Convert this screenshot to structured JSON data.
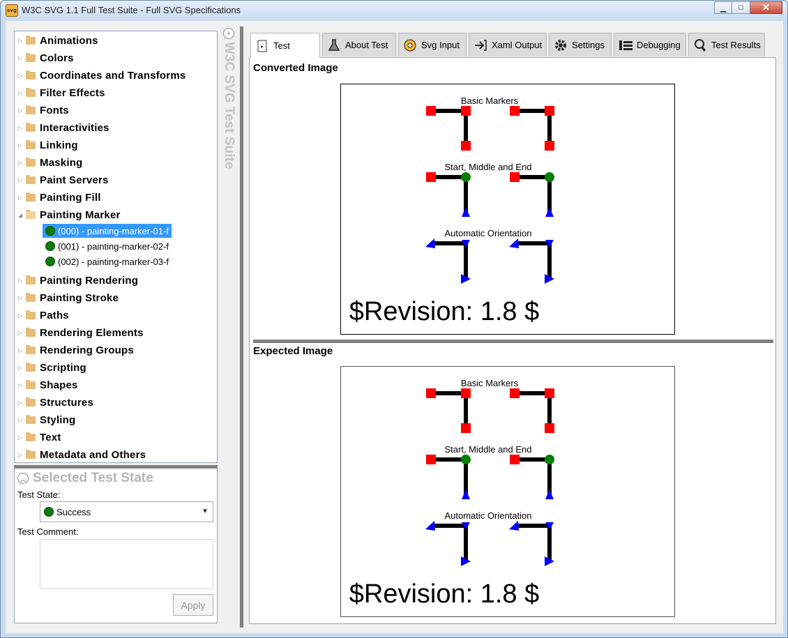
{
  "window": {
    "title": "W3C SVG 1.1 Full Test Suite - Full SVG Specifications",
    "icon_text": "svg"
  },
  "strip": {
    "title": "W3C SVG Test Suite"
  },
  "tree": {
    "categories": [
      "Animations",
      "Colors",
      "Coordinates and Transforms",
      "Filter Effects",
      "Fonts",
      "Interactivities",
      "Linking",
      "Masking",
      "Paint Servers",
      "Painting Fill",
      "Painting Marker",
      "Painting Rendering",
      "Painting Stroke",
      "Paths",
      "Rendering Elements",
      "Rendering Groups",
      "Scripting",
      "Shapes",
      "Structures",
      "Styling",
      "Text",
      "Metadata and Others"
    ],
    "expanded": "Painting Marker",
    "children": [
      {
        "label": "(000) - painting-marker-01-f",
        "selected": true
      },
      {
        "label": "(001) - painting-marker-02-f",
        "selected": false
      },
      {
        "label": "(002) - painting-marker-03-f",
        "selected": false
      }
    ]
  },
  "state": {
    "title": "Selected Test State",
    "state_label": "Test State:",
    "state_value": "Success",
    "comment_label": "Test Comment:",
    "apply_label": "Apply"
  },
  "tabs": [
    {
      "label": "Test",
      "icon": "document-icon",
      "active": true
    },
    {
      "label": "About Test",
      "icon": "flask-icon"
    },
    {
      "label": "Svg Input",
      "icon": "svg-badge-icon"
    },
    {
      "label": "Xaml Output",
      "icon": "export-icon"
    },
    {
      "label": "Settings",
      "icon": "gear-icon"
    },
    {
      "label": "Debugging",
      "icon": "list-icon"
    },
    {
      "label": "Test Results",
      "icon": "magnifier-icon"
    }
  ],
  "panels": {
    "converted_title": "Converted Image",
    "expected_title": "Expected Image"
  },
  "svg_test": {
    "heading1": "Basic Markers",
    "heading2": "Start, Middle and End",
    "heading3": "Automatic Orientation",
    "revision": "$Revision: 1.8 $"
  },
  "colors": {
    "selection": "#3399ff",
    "success": "#0a7a0a",
    "marker_red": "#ff0000",
    "marker_blue": "#0000ff",
    "marker_green": "#008000"
  }
}
